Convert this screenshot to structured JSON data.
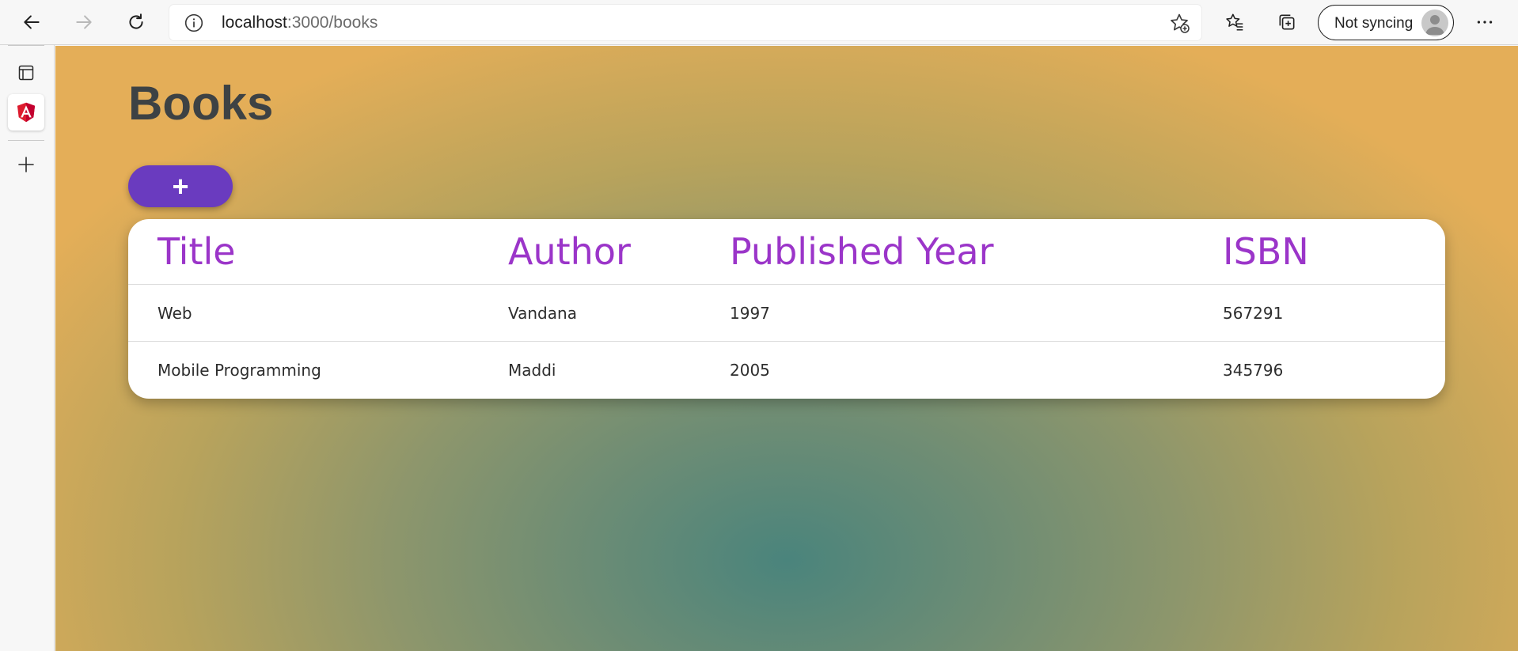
{
  "browser": {
    "url_host": "localhost",
    "url_path": ":3000/books",
    "sync_label": "Not syncing",
    "icons": [
      "back-icon",
      "forward-icon",
      "refresh-icon",
      "info-icon",
      "add-favorite-icon",
      "favorites-icon",
      "collections-icon",
      "more-icon"
    ]
  },
  "sidebar": {
    "icons": [
      "tab-actions-icon",
      "angular-icon",
      "plus-icon"
    ]
  },
  "page": {
    "title": "Books",
    "add_button_label": "+"
  },
  "table": {
    "columns": [
      "Title",
      "Author",
      "Published Year",
      "ISBN"
    ],
    "rows": [
      [
        "Web",
        "Vandana",
        "1997",
        "567291"
      ],
      [
        "Mobile Programming",
        "Maddi",
        "2005",
        "345796"
      ]
    ]
  },
  "colors": {
    "accent_button": "#6a3bbf",
    "header_text": "#9b35c9",
    "gradient_center": "#4a847c",
    "gradient_edge": "#e4ae58"
  }
}
